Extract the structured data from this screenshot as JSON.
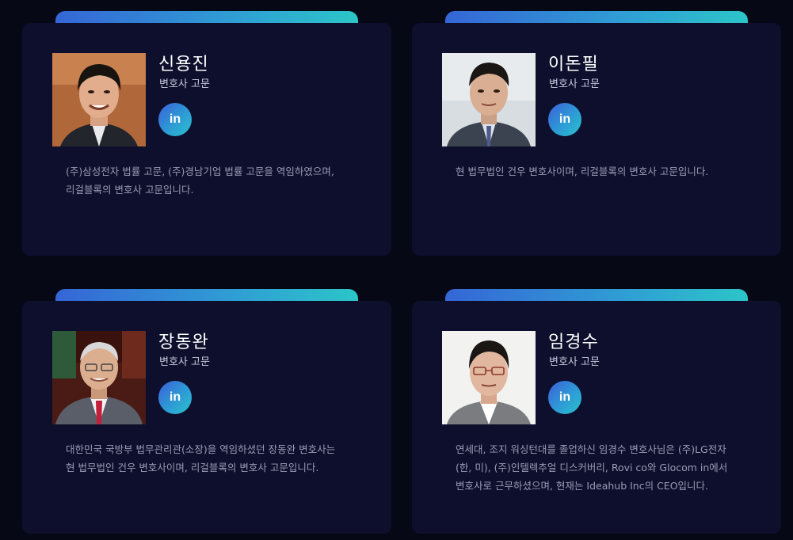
{
  "cards": [
    {
      "name": "신용진",
      "role": "변호사 고문",
      "linkedin_label": "in",
      "description": "(주)삼성전자 법률 고문, (주)경남기업 법률 고문을 역임하였으며, 리걸블록의 변호사 고문입니다."
    },
    {
      "name": "이돈필",
      "role": "변호사 고문",
      "linkedin_label": "in",
      "description": "현 법무법인 건우 변호사이며, 리걸블록의 변호사 고문입니다."
    },
    {
      "name": "장동완",
      "role": "변호사 고문",
      "linkedin_label": "in",
      "description": "대한민국 국방부 법무관리관(소장)을 역임하셨던 장동완 변호사는 현 법무법인 건우 변호사이며, 리걸블록의 변호사 고문입니다."
    },
    {
      "name": "임경수",
      "role": "변호사 고문",
      "linkedin_label": "in",
      "description": "연세대, 조지 워싱턴대를 졸업하신 임경수 변호사님은 (주)LG전자(한, 미), (주)인텔렉추얼 디스커버리, Rovi co와 Glocom in에서 변호사로 근무하셨으며, 현재는 Ideahub Inc의 CEO입니다."
    }
  ],
  "colors": {
    "page_bg": "#070816",
    "card_bg": "#0d0f2c",
    "accent_start": "#3566d6",
    "accent_end": "#2cc5c8"
  },
  "icons": {
    "linkedin": "linkedin-icon"
  }
}
